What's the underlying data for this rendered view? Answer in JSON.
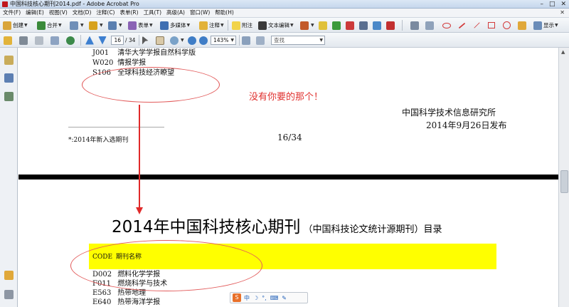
{
  "window": {
    "title": "中国科技核心期刊2014.pdf - Adobe Acrobat Pro",
    "controls": [
      "–",
      "□",
      "✕"
    ]
  },
  "menu": {
    "items": [
      "文件(F)",
      "编辑(E)",
      "视图(V)",
      "文档(D)",
      "注释(C)",
      "表单(R)",
      "工具(T)",
      "高级(A)",
      "窗口(W)",
      "帮助(H)"
    ],
    "close": "✕"
  },
  "toolbar1": {
    "create": "创建",
    "combine": "合并",
    "forms": "表单",
    "multimedia": "多媒体",
    "comment": "注释",
    "attach": "附注",
    "text_edit": "文本编辑",
    "display": "显示"
  },
  "toolbar2": {
    "page_current": "16",
    "page_total": "/ 34",
    "zoom": "143%",
    "find_placeholder": "查找"
  },
  "page1": {
    "entries": [
      {
        "code": "J001",
        "name": "清华大学学报自然科学版"
      },
      {
        "code": "W020",
        "name": "情报学报"
      },
      {
        "code": "S106",
        "name": "全球科技经济瞭望"
      }
    ],
    "org": "中国科学技术信息研究所",
    "date": "2014年9月26日发布",
    "rule": "______________________________",
    "footnote": "*:2014年新入选期刊",
    "page_number": "16/34"
  },
  "annotation": {
    "text": "没有你要的那个！",
    "color": "#e0312f"
  },
  "page2": {
    "title_main": "2014年中国科技核心期刊",
    "title_sub": "（中国科技论文统计源期刊）目录",
    "header_code": "CODE",
    "header_name": "期刊名称",
    "header_color": "#ffff00",
    "entries": [
      {
        "code": "D002",
        "name": "燃料化学学报"
      },
      {
        "code": "F011",
        "name": "燃烧科学与技术"
      },
      {
        "code": "E563",
        "name": "热带地理"
      },
      {
        "code": "E640",
        "name": "热带海洋学报"
      }
    ]
  },
  "ime": {
    "logo": "S",
    "mode": "中"
  }
}
